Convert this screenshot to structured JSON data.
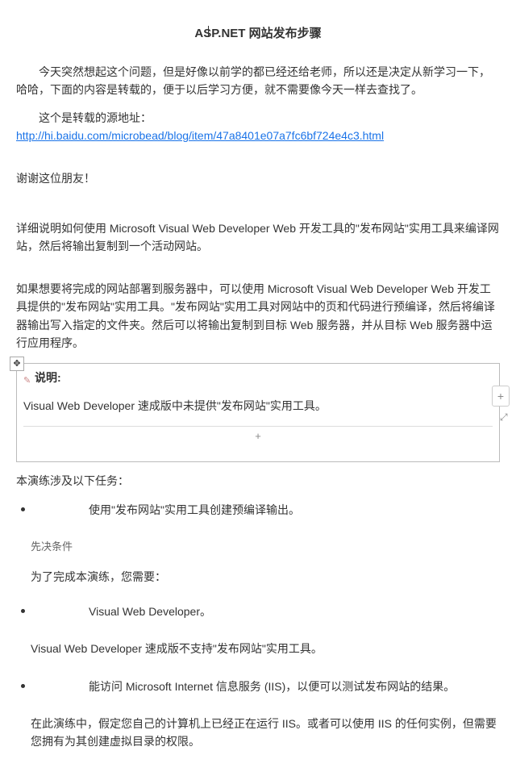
{
  "title": "ASP.NET 网站发布步骤",
  "intro1": "今天突然想起这个问题，但是好像以前学的都已经还给老师，所以还是决定从新学习一下，哈哈，下面的内容是转载的，便于以后学习方便，就不需要像今天一样去查找了。",
  "intro2_prefix": "这个是转载的源地址：",
  "intro2_link": "http://hi.baidu.com/microbead/blog/item/47a8401e07a7fc6bf724e4c3.html",
  "thanks": "谢谢这位朋友！",
  "para1": "详细说明如何使用 Microsoft Visual Web Developer Web 开发工具的\"发布网站\"实用工具来编译网站，然后将输出复制到一个活动网站。",
  "para2": "如果想要将完成的网站部署到服务器中，可以使用 Microsoft Visual Web Developer Web 开发工具提供的\"发布网站\"实用工具。\"发布网站\"实用工具对网站中的页和代码进行预编译，然后将编译器输出写入指定的文件夹。然后可以将输出复制到目标 Web 服务器，并从目标 Web 服务器中运行应用程序。",
  "note": {
    "label": "说明:",
    "body": "Visual Web Developer 速成版中未提供\"发布网站\"实用工具。"
  },
  "tasks_intro": "本演练涉及以下任务：",
  "task1": "使用\"发布网站\"实用工具创建预编译输出。",
  "prereq_head": "先决条件",
  "prereq_intro": "为了完成本演练，您需要：",
  "req1": "Visual Web Developer。",
  "req1_note": "Visual Web Developer 速成版不支持\"发布网站\"实用工具。",
  "req2": "能访问 Microsoft Internet 信息服务 (IIS)，以便可以测试发布网站的结果。",
  "closing": "在此演练中，假定您自己的计算机上已经正在运行 IIS。或者可以使用 IIS 的任何实例，但需要您拥有为其创建虚拟目录的权限。",
  "icons": {
    "move": "✥",
    "plus": "+",
    "expand": "⤢",
    "pen": "✎"
  }
}
